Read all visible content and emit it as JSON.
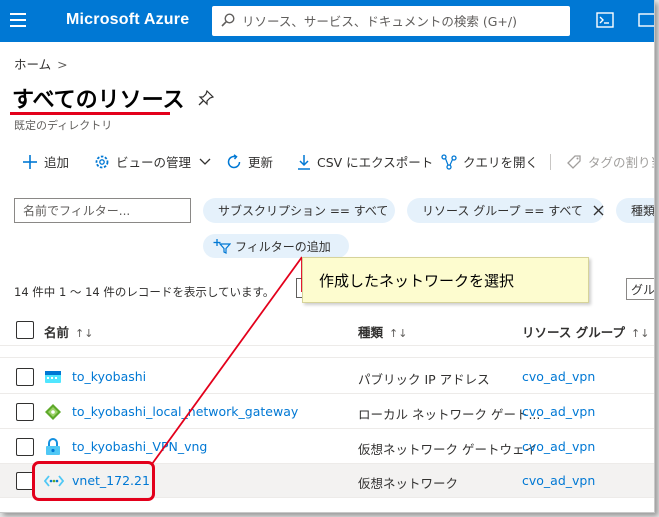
{
  "header": {
    "brand": "Microsoft Azure",
    "search_placeholder": "リソース、サービス、ドキュメントの検索 (G+/)"
  },
  "breadcrumb": {
    "home": "ホーム",
    "separator": ">"
  },
  "page": {
    "title": "すべてのリソース",
    "subtitle": "既定のディレクトリ"
  },
  "toolbar": {
    "add": "追加",
    "manage_view": "ビューの管理",
    "refresh": "更新",
    "export_csv": "CSV にエクスポート",
    "open_query": "クエリを開く",
    "tag_assign": "タグの割り当"
  },
  "filters": {
    "name_placeholder": "名前でフィルター...",
    "subscription": "サブスクリプション == すべて",
    "resource_group": "リソース グループ == すべて",
    "type": "種類",
    "add_filter": "フィルターの追加"
  },
  "record_count": "14 件中 1 ～ 14 件のレコードを表示しています。",
  "right_button": "グル",
  "table": {
    "headers": {
      "name": "名前",
      "type": "種類",
      "resource_group": "リソース グループ"
    },
    "rows": [
      {
        "name": "to_kyobashi",
        "type": "パブリック IP アドレス",
        "resource_group": "cvo_ad_vpn",
        "icon": "public-ip-icon"
      },
      {
        "name": "to_kyobashi_local_network_gateway",
        "type": "ローカル ネットワーク ゲート...",
        "resource_group": "cvo_ad_vpn",
        "icon": "local-network-gateway-icon"
      },
      {
        "name": "to_kyobashi_VPN_vng",
        "type": "仮想ネットワーク ゲートウェイ",
        "resource_group": "cvo_ad_vpn",
        "icon": "vpn-gateway-icon"
      },
      {
        "name": "vnet_172.21",
        "type": "仮想ネットワーク",
        "resource_group": "cvo_ad_vpn",
        "icon": "virtual-network-icon"
      }
    ]
  },
  "annotation": {
    "callout_text": "作成したネットワークを選択"
  },
  "colors": {
    "azure_blue": "#0078d4",
    "annotation_red": "#e3001b",
    "callout_bg": "#fdfccf",
    "pill_bg": "#e5f1fb"
  }
}
